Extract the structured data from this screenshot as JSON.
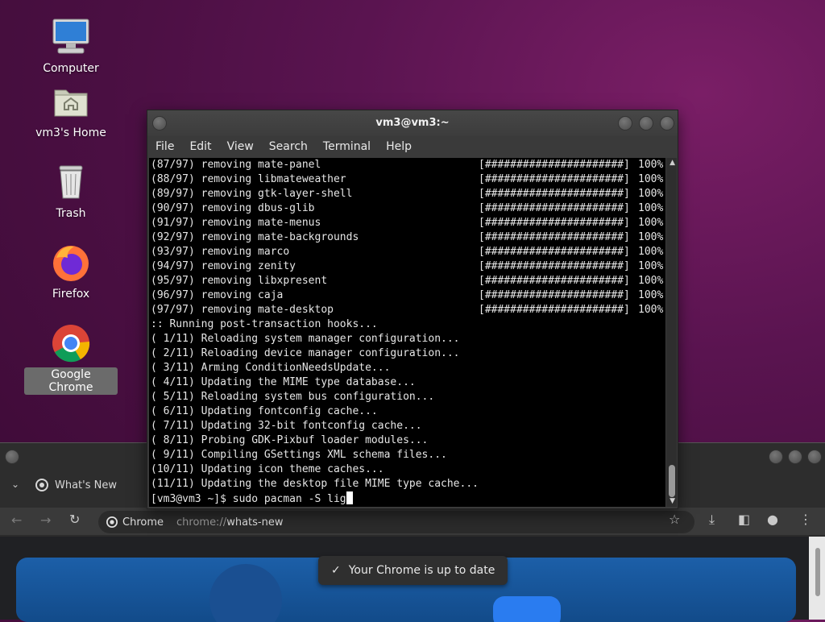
{
  "desktop": {
    "icons": [
      {
        "label": "Computer"
      },
      {
        "label": "vm3's Home"
      },
      {
        "label": "Trash"
      },
      {
        "label": "Firefox"
      },
      {
        "label": "Google Chrome"
      }
    ]
  },
  "terminal": {
    "title": "vm3@vm3:~",
    "menu": [
      "File",
      "Edit",
      "View",
      "Search",
      "Terminal",
      "Help"
    ],
    "removing": [
      {
        "text": "(87/97) removing mate-panel",
        "bar": "[######################]",
        "pct": "100%"
      },
      {
        "text": "(88/97) removing libmateweather",
        "bar": "[######################]",
        "pct": "100%"
      },
      {
        "text": "(89/97) removing gtk-layer-shell",
        "bar": "[######################]",
        "pct": "100%"
      },
      {
        "text": "(90/97) removing dbus-glib",
        "bar": "[######################]",
        "pct": "100%"
      },
      {
        "text": "(91/97) removing mate-menus",
        "bar": "[######################]",
        "pct": "100%"
      },
      {
        "text": "(92/97) removing mate-backgrounds",
        "bar": "[######################]",
        "pct": "100%"
      },
      {
        "text": "(93/97) removing marco",
        "bar": "[######################]",
        "pct": "100%"
      },
      {
        "text": "(94/97) removing zenity",
        "bar": "[######################]",
        "pct": "100%"
      },
      {
        "text": "(95/97) removing libxpresent",
        "bar": "[######################]",
        "pct": "100%"
      },
      {
        "text": "(96/97) removing caja",
        "bar": "[######################]",
        "pct": "100%"
      },
      {
        "text": "(97/97) removing mate-desktop",
        "bar": "[######################]",
        "pct": "100%"
      }
    ],
    "hooks": [
      ":: Running post-transaction hooks...",
      "( 1/11) Reloading system manager configuration...",
      "( 2/11) Reloading device manager configuration...",
      "( 3/11) Arming ConditionNeedsUpdate...",
      "( 4/11) Updating the MIME type database...",
      "( 5/11) Reloading system bus configuration...",
      "( 6/11) Updating fontconfig cache...",
      "( 7/11) Updating 32-bit fontconfig cache...",
      "( 8/11) Probing GDK-Pixbuf loader modules...",
      "( 9/11) Compiling GSettings XML schema files...",
      "(10/11) Updating icon theme caches...",
      "(11/11) Updating the desktop file MIME type cache..."
    ],
    "prompt": "[vm3@vm3 ~]$ sudo pacman -S lig"
  },
  "chrome": {
    "tab_title": "What's New",
    "omnibox_chip": "Chrome",
    "url_scheme": "chrome://",
    "url_path": "whats-new",
    "toast": "Your Chrome is up to date"
  }
}
